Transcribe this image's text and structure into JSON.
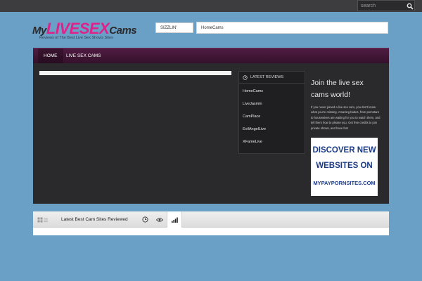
{
  "search": {
    "placeholder": "search"
  },
  "logo": {
    "part1": "My",
    "part2": "LIVESEX",
    "part3": "Cams",
    "tagline": "Reviews of The Best Live Sex Shows Sites"
  },
  "ticker": {
    "label": "SIZZLIN'",
    "text": "HomeCams"
  },
  "nav": {
    "items": [
      "HOME",
      "LIVE SEX CAMS"
    ]
  },
  "reviews": {
    "title": "LATEST REVIEWS",
    "items": [
      "HomeCams",
      "LiveJasmin",
      "CamPlace",
      "EvilAngelLive",
      "XFameLive"
    ]
  },
  "sidebar": {
    "title": "Join the live sex cams world!",
    "text": "If you never joined a live sex cam, you don't know what you're missing. Amazing babes, from pornstars to housewives are waiting for you to watch them, and tell them how to please you. Get free credits to join private shows, and have fun!",
    "banner": {
      "line1": "DISCOVER NEW",
      "line2": "WEBSITES ON",
      "line3": "MYPAYPORNSITES.COM"
    }
  },
  "bottom": {
    "title": "Latest Best Cam Sites Reviewed"
  },
  "colors": {
    "accent": "#e0218a",
    "nav": "#4f1c42",
    "background": "#6a9fc6",
    "panel": "#2a2a2c"
  },
  "icons": [
    "search-icon",
    "clock-icon",
    "grid-icon",
    "list-icon",
    "eye-icon",
    "bars-icon"
  ]
}
